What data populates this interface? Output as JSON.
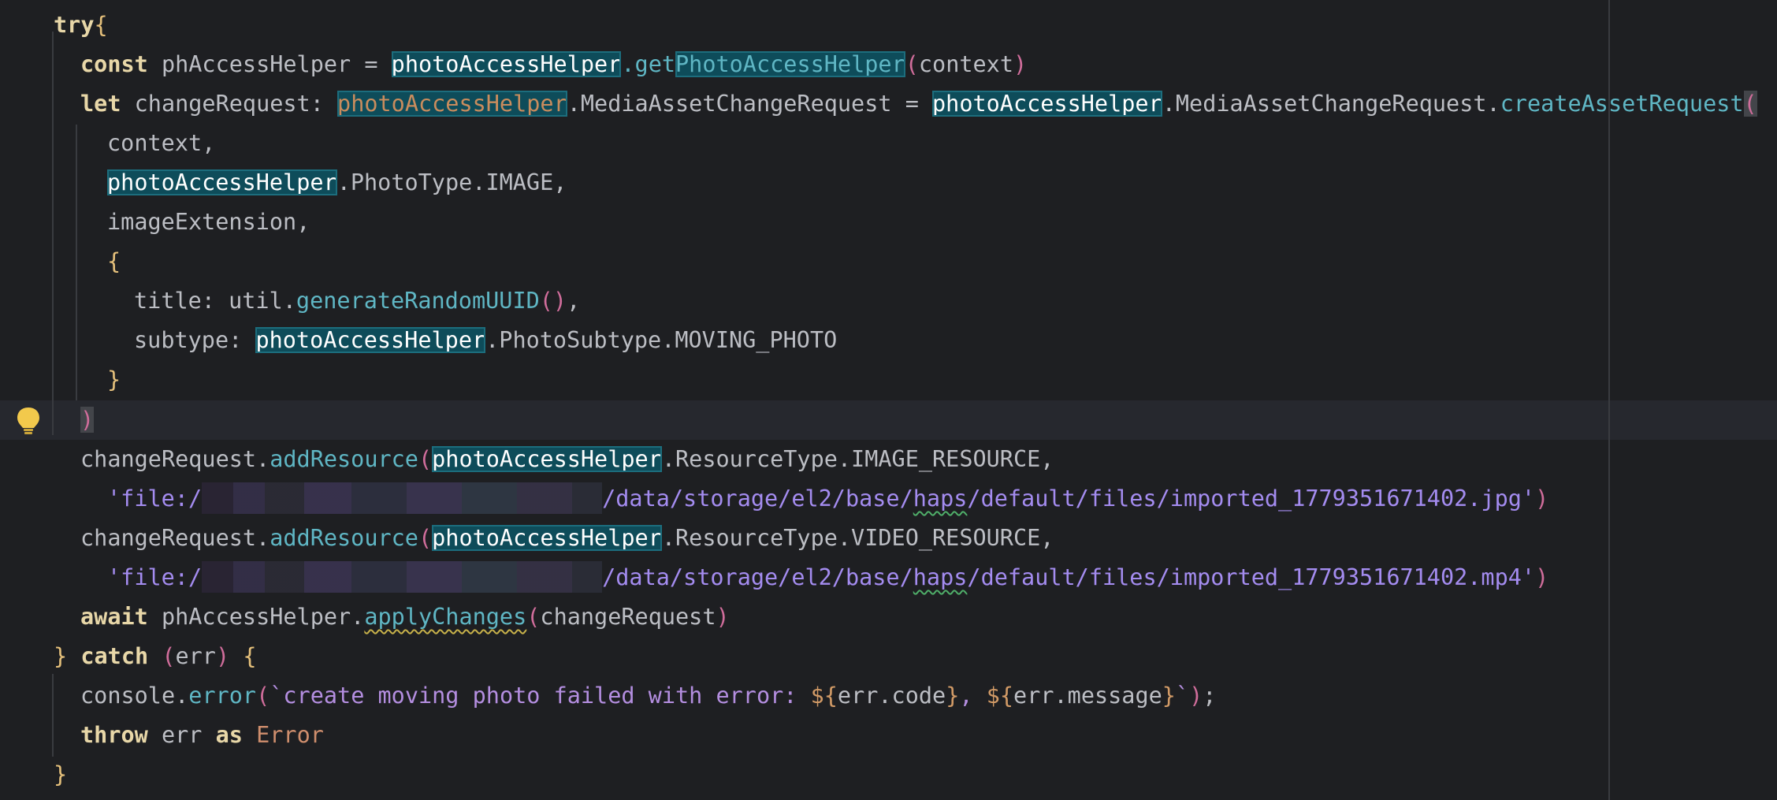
{
  "editor": {
    "lines": {
      "l1": {
        "try": "try",
        "brace": "{"
      },
      "l2": {
        "const": "const",
        "name": " phAccessHelper = ",
        "obj": "photoAccessHelper",
        "dot": ".",
        "get": "get",
        "method": "PhotoAccessHelper",
        "lp": "(",
        "arg": "context",
        "rp": ")"
      },
      "l3": {
        "let": "let",
        "name": " changeRequest: ",
        "obj1": "photoAccessHelper",
        "type": ".MediaAssetChangeRequest = ",
        "obj2": "photoAccessHelper",
        "type2": ".MediaAssetChangeRequest.",
        "method": "createAssetRequest",
        "lp": "("
      },
      "l4": {
        "text": "context,"
      },
      "l5": {
        "obj": "photoAccessHelper",
        "rest": ".PhotoType.IMAGE,"
      },
      "l6": {
        "text": "imageExtension,"
      },
      "l7": {
        "brace": "{"
      },
      "l8": {
        "key": "title: util.",
        "method": "generateRandomUUID",
        "parens": "()",
        "comma": ","
      },
      "l9": {
        "key": "subtype: ",
        "obj": "photoAccessHelper",
        "rest": ".PhotoSubtype.MOVING_PHOTO"
      },
      "l10": {
        "brace": "}"
      },
      "l11": {
        "paren": ")"
      },
      "l12": {
        "pre": "changeRequest.",
        "method": "addResource",
        "lp": "(",
        "obj": "photoAccessHelper",
        "rest": ".ResourceType.IMAGE_RESOURCE,"
      },
      "l13": {
        "q": "'file:/",
        "p1": "/data/storage/el2/base/",
        "haps": "haps",
        "p2": "/default/files/imported_1779351671402.jpg'",
        "rp": ")"
      },
      "l14": {
        "pre": "changeRequest.",
        "method": "addResource",
        "lp": "(",
        "obj": "photoAccessHelper",
        "rest": ".ResourceType.VIDEO_RESOURCE,"
      },
      "l15": {
        "q": "'file:/",
        "p1": "/data/storage/el2/base/",
        "haps": "haps",
        "p2": "/default/files/imported_1779351671402.mp4'",
        "rp": ")"
      },
      "l16": {
        "await": "await",
        "pre": " phAccessHelper.",
        "method": "applyChanges",
        "lp": "(",
        "arg": "changeRequest",
        "rp": ")"
      },
      "l17": {
        "rb": "}",
        "catch": "catch",
        "lp": "(",
        "arg": "err",
        "rp": ")",
        "lb": "{"
      },
      "l18": {
        "pre": "console.",
        "method": "error",
        "lp": "(",
        "t1": "`create moving photo failed with error: ",
        "d1": "${",
        "e1": "err.code",
        "c1": "}",
        "sep": ", ",
        "d2": "${",
        "e2": "err.message",
        "c2": "}",
        "t2": "`",
        "rp": ")",
        "semi": ";"
      },
      "l19": {
        "throw": "throw",
        "mid": " err ",
        "as": "as",
        "type": "Error"
      },
      "l20": {
        "brace": "}"
      }
    }
  },
  "colors": {
    "background": "#1e1f22",
    "keyword": "#cf8e6d",
    "method": "#56a8f5",
    "string": "#c77dbb",
    "highlight": "#0e4c5a"
  },
  "icons": {
    "intention": "lightbulb-icon"
  }
}
